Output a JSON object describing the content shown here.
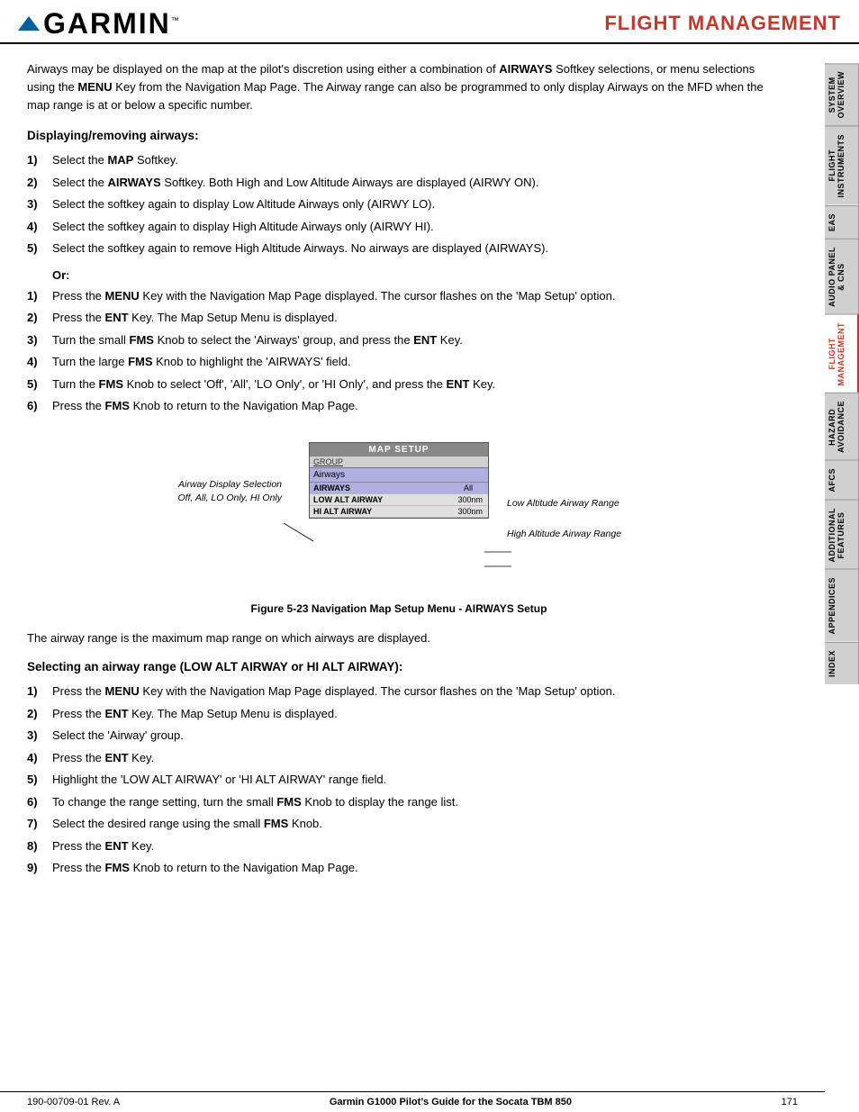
{
  "header": {
    "title": "FLIGHT MANAGEMENT",
    "logo_text": "GARMIN",
    "logo_tm": "™"
  },
  "sidebar": {
    "tabs": [
      {
        "id": "system-overview",
        "label": "SYSTEM OVERVIEW",
        "active": false
      },
      {
        "id": "flight-instruments",
        "label": "FLIGHT INSTRUMENTS",
        "active": false
      },
      {
        "id": "eas",
        "label": "EAS",
        "active": false
      },
      {
        "id": "audio-panel-cns",
        "label": "AUDIO PANEL & CNS",
        "active": false
      },
      {
        "id": "flight-management",
        "label": "FLIGHT MANAGEMENT",
        "active": true
      },
      {
        "id": "hazard-avoidance",
        "label": "HAZARD AVOIDANCE",
        "active": false
      },
      {
        "id": "afcs",
        "label": "AFCS",
        "active": false
      },
      {
        "id": "additional-features",
        "label": "ADDITIONAL FEATURES",
        "active": false
      },
      {
        "id": "appendices",
        "label": "APPENDICES",
        "active": false
      },
      {
        "id": "index",
        "label": "INDEX",
        "active": false
      }
    ]
  },
  "content": {
    "intro": "Airways may be displayed on the map at the pilot's discretion using either a combination of AIRWAYS Softkey selections, or menu selections using the MENU Key from the Navigation Map Page.  The Airway range can also be programmed to only display Airways on the MFD when the map range is at or below a specific number.",
    "section1_heading": "Displaying/removing airways:",
    "section1_steps": [
      {
        "num": "1)",
        "text": "Select the MAP Softkey."
      },
      {
        "num": "2)",
        "text": "Select the AIRWAYS Softkey. Both High and Low Altitude Airways are displayed (AIRWY ON)."
      },
      {
        "num": "3)",
        "text": "Select the softkey again to display Low Altitude Airways only (AIRWY LO)."
      },
      {
        "num": "4)",
        "text": "Select the softkey again to display High Altitude Airways only (AIRWY HI)."
      },
      {
        "num": "5)",
        "text": "Select the softkey again to remove High Altitude Airways. No airways are displayed (AIRWAYS)."
      }
    ],
    "or_text": "Or:",
    "section1b_steps": [
      {
        "num": "1)",
        "text": "Press the MENU Key with the Navigation Map Page displayed.  The cursor flashes on the ‘Map Setup’ option."
      },
      {
        "num": "2)",
        "text": "Press the ENT Key.  The Map Setup Menu is displayed."
      },
      {
        "num": "3)",
        "text": "Turn the small FMS Knob to select the ‘Airways’ group, and press the ENT Key."
      },
      {
        "num": "4)",
        "text": "Turn the large FMS Knob to highlight the ‘AIRWAYS’ field."
      },
      {
        "num": "5)",
        "text": "Turn the FMS Knob to select ‘Off’, ‘All’, ‘LO Only’, or ‘HI Only’, and press the ENT Key."
      },
      {
        "num": "6)",
        "text": "Press the FMS Knob to return to the Navigation Map Page."
      }
    ],
    "diagram": {
      "title": "MAP SETUP",
      "group_label": "GROUP",
      "group_value": "Airways",
      "rows": [
        {
          "label": "AIRWAYS",
          "value": "All",
          "range": ""
        },
        {
          "label": "LOW ALT AIRWAY",
          "value": "",
          "range": "300nm"
        },
        {
          "label": "HI ALT AIRWAY",
          "value": "",
          "range": "300nm"
        }
      ],
      "left_annotation": "Airway Display Selection\nOff, All, LO Only, HI Only",
      "right_annotation_low": "Low Altitude Airway Range",
      "right_annotation_high": "High Altitude Airway Range"
    },
    "figure_caption": "Figure 5-23  Navigation Map Setup Menu - AIRWAYS Setup",
    "airway_range_text": "The airway range is the maximum map range on which airways are displayed.",
    "section2_heading": "Selecting an airway range (LOW ALT AIRWAY or HI ALT AIRWAY):",
    "section2_steps": [
      {
        "num": "1)",
        "text": "Press the MENU Key with the Navigation Map Page displayed.  The cursor flashes on the ‘Map Setup’ option."
      },
      {
        "num": "2)",
        "text": "Press the ENT Key.  The Map Setup Menu is displayed."
      },
      {
        "num": "3)",
        "text": "Select the ‘Airway’ group."
      },
      {
        "num": "4)",
        "text": "Press the ENT Key."
      },
      {
        "num": "5)",
        "text": "Highlight the ‘LOW ALT AIRWAY’ or ‘HI ALT AIRWAY’ range field."
      },
      {
        "num": "6)",
        "text": "To change the range setting, turn the small FMS Knob to display the range list."
      },
      {
        "num": "7)",
        "text": "Select the desired range using the small FMS Knob."
      },
      {
        "num": "8)",
        "text": "Press the ENT Key."
      },
      {
        "num": "9)",
        "text": "Press the FMS Knob to return to the Navigation Map Page."
      }
    ]
  },
  "footer": {
    "left": "190-00709-01  Rev. A",
    "center": "Garmin G1000 Pilot’s Guide for the Socata TBM 850",
    "right": "171"
  }
}
